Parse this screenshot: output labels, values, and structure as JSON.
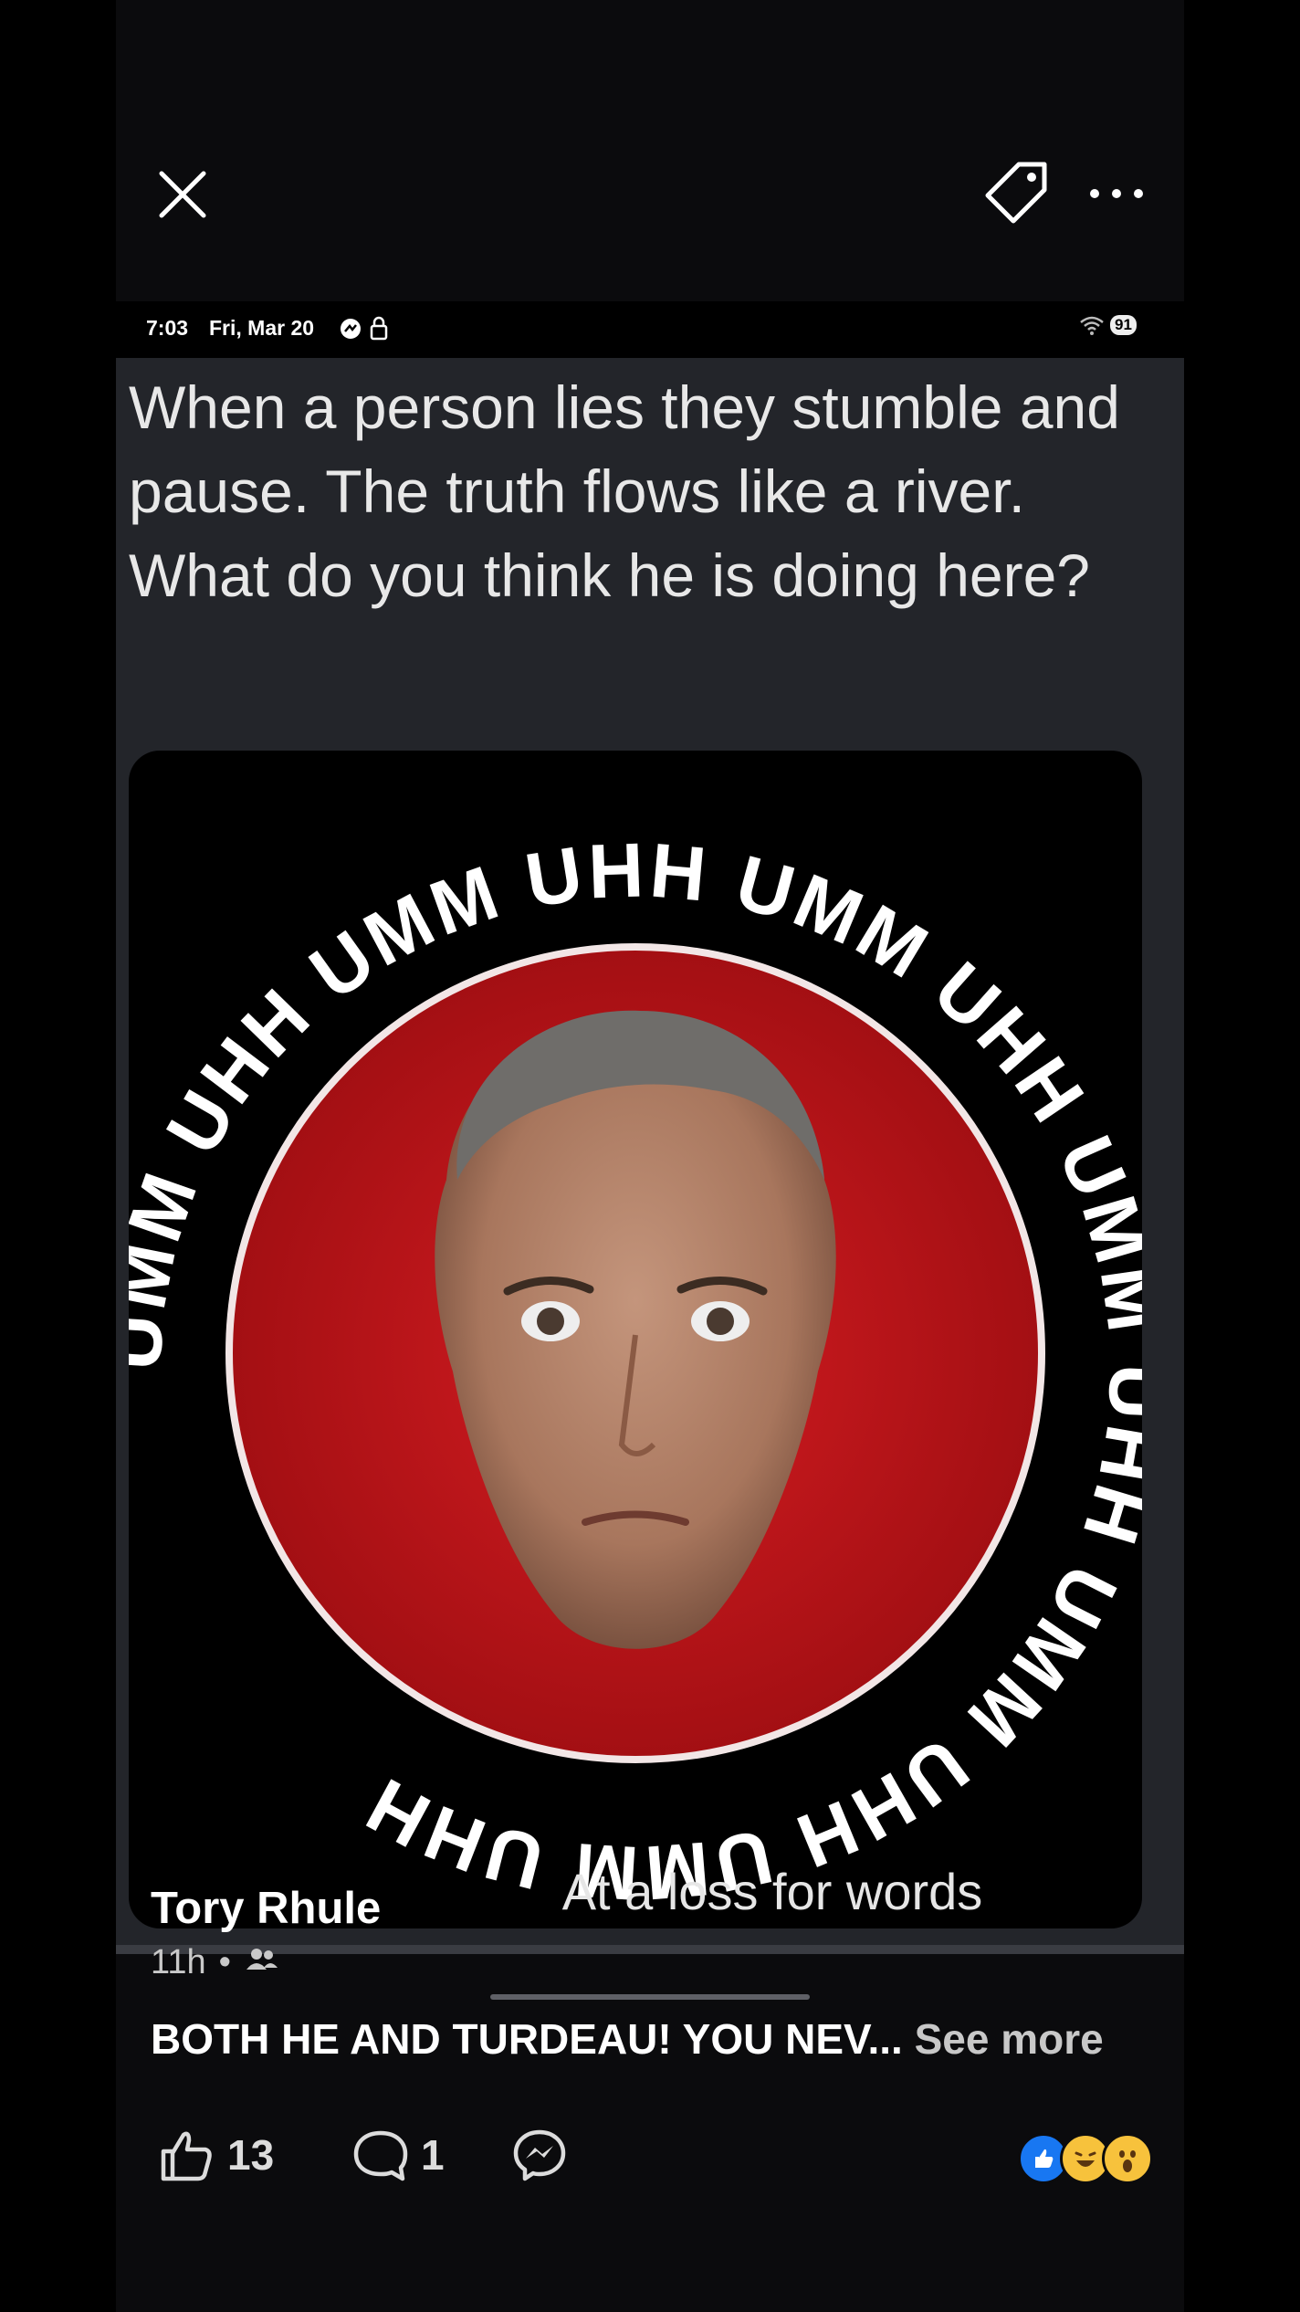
{
  "viewer": {
    "close_label": "Close",
    "tag_label": "Tag",
    "more_label": "More"
  },
  "screenshot": {
    "status": {
      "time": "7:03",
      "date": "Fri, Mar 20",
      "battery": "91"
    },
    "post_text": "When a person lies they stumble and pause. The truth flows like a river. What do you think he is doing here?",
    "image": {
      "ring_text": "UMM UHH UMM UHH UMM UHH UMM UHH UMM UHH UMM UHH",
      "caption": "At a loss for words",
      "colors": {
        "ring": "#c8161b",
        "border": "#f2e6e6"
      }
    }
  },
  "post": {
    "author": "Tory Rhule",
    "time": "11h",
    "audience_icon": "friends-icon",
    "caption": "BOTH HE AND TURDEAU! YOU NEV...",
    "see_more": "See more"
  },
  "actions": {
    "like_count": "13",
    "comment_count": "1",
    "reactions": [
      "like",
      "haha",
      "wow"
    ]
  }
}
